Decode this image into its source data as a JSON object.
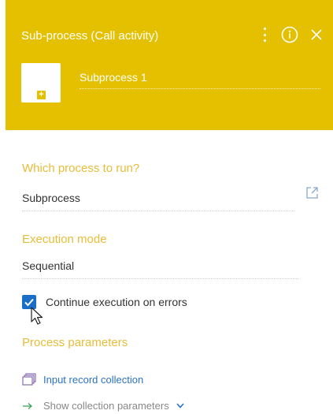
{
  "header": {
    "title": "Sub-process (Call activity)",
    "element_name": "Subprocess 1",
    "background_color": "#e5c000",
    "icons": [
      "more-vertical-icon",
      "info-icon",
      "close-icon",
      "plus-icon"
    ]
  },
  "fields": {
    "process_label": "Which process to run?",
    "process_value": "Subprocess",
    "mode_label": "Execution mode",
    "mode_value": "Sequential",
    "continue_on_errors_label": "Continue execution on errors",
    "continue_on_errors_checked": true
  },
  "parameters": {
    "section_label": "Process parameters",
    "input_collection_label": "Input record collection",
    "show_params_label": "Show collection parameters"
  },
  "colors": {
    "accent_label": "#e7bd3a",
    "link": "#2a73c5",
    "checkbox": "#1a6ec8"
  }
}
